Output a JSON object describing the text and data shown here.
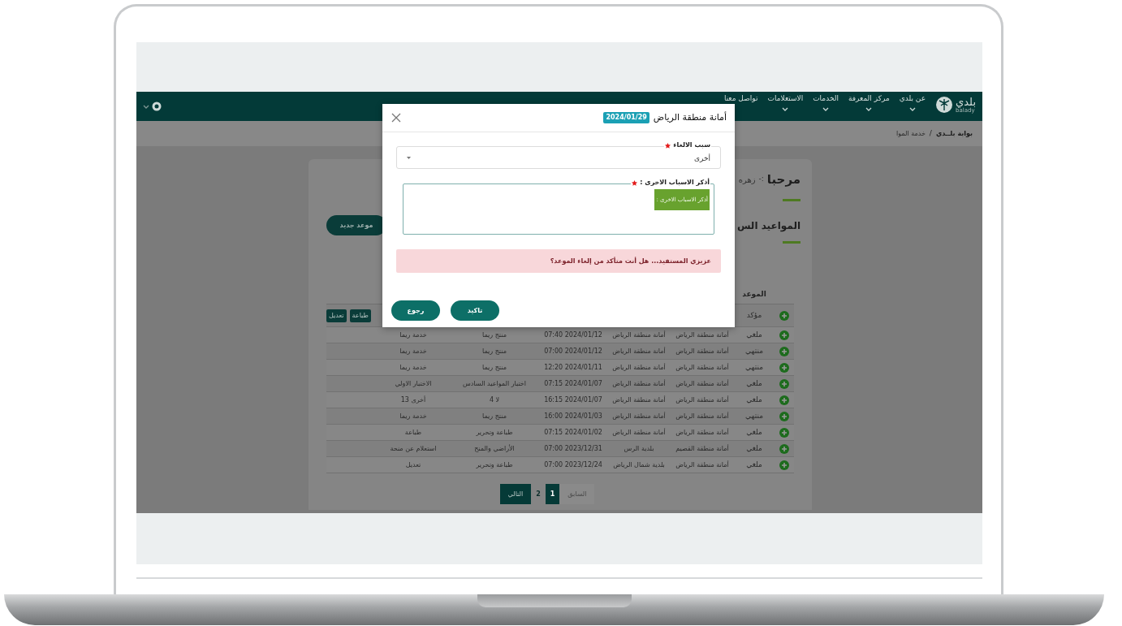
{
  "nav": {
    "logo_text": "بلدي",
    "logo_subtext": "balady",
    "items": [
      {
        "label": "عن بلدي",
        "dropdown": true
      },
      {
        "label": "مركز المعرفة",
        "dropdown": true
      },
      {
        "label": "الخدمات",
        "dropdown": true
      },
      {
        "label": "الاستعلامات",
        "dropdown": true
      },
      {
        "label": "تواصل معنا",
        "dropdown": false
      }
    ]
  },
  "breadcrumb": {
    "items": [
      "بوابة بلــدي",
      "خدمة الموا"
    ],
    "separator": "/"
  },
  "welcome": {
    "greeting": "مرحبا",
    "separator": ":-",
    "name": "زهره"
  },
  "section_title": "المواعيد الس",
  "new_button": "موعد جديد",
  "table": {
    "columns": [
      {
        "label": "الموعد"
      }
    ],
    "rows": [
      {
        "kind": "actions",
        "status": "مؤكد",
        "actions": [
          "طباعة",
          "تعديل"
        ]
      },
      {
        "kind": "data",
        "status": "ملغي",
        "cells": [
          "أمانة منطقة الرياض",
          "أمانة منطقة الرياض",
          "07:40 2024/01/12",
          "منتج ريما",
          "خدمة ريما"
        ]
      },
      {
        "kind": "data",
        "status": "منتهي",
        "cells": [
          "أمانة منطقة الرياض",
          "أمانة منطقة الرياض",
          "07:00 2024/01/12",
          "منتج ريما",
          "خدمة ريما"
        ]
      },
      {
        "kind": "data",
        "status": "منتهي",
        "cells": [
          "أمانة منطقة الرياض",
          "أمانة منطقة الرياض",
          "12:20 2024/01/11",
          "منتج ريما",
          "خدمة ريما"
        ]
      },
      {
        "kind": "data",
        "status": "ملغي",
        "cells": [
          "أمانة منطقة الرياض",
          "أمانة منطقة الرياض",
          "07:15 2024/01/07",
          "اختبار المواعيد السادس",
          "الاختبار الاولي"
        ]
      },
      {
        "kind": "data",
        "status": "ملغي",
        "cells": [
          "أمانة منطقة الرياض",
          "أمانة منطقة الرياض",
          "16:15 2024/01/07",
          "لا 4",
          "أخرى 13"
        ]
      },
      {
        "kind": "data",
        "status": "منتهي",
        "cells": [
          "أمانة منطقة الرياض",
          "أمانة منطقة الرياض",
          "16:00 2024/01/03",
          "منتج ريما",
          "خدمة ريما"
        ]
      },
      {
        "kind": "data",
        "status": "ملغي",
        "cells": [
          "أمانة منطقة الرياض",
          "أمانة منطقة الرياض",
          "07:15 2024/01/02",
          "طباعة وتحرير",
          "طباعة"
        ]
      },
      {
        "kind": "data",
        "status": "ملغي",
        "cells": [
          "أمانة منطقة القصيم",
          "بلدية الرس",
          "07:00 2023/12/31",
          "الأراضي والمنح",
          "استعلام عن منحة"
        ]
      },
      {
        "kind": "data",
        "status": "ملغي",
        "cells": [
          "أمانة منطقة الرياض",
          "بلدية شمال الرياض",
          "07:00 2023/12/24",
          "طباعة وتحرير",
          "تعديل"
        ]
      }
    ]
  },
  "pagination": [
    {
      "label": "السابق",
      "kind": "prev",
      "selected": false,
      "disabled": true
    },
    {
      "label": "1",
      "kind": "page",
      "selected": true,
      "disabled": false
    },
    {
      "label": "2",
      "kind": "page",
      "selected": false,
      "disabled": false
    },
    {
      "label": "التالي",
      "kind": "next",
      "selected": false,
      "disabled": false
    }
  ],
  "modal": {
    "title": "أمانة منطقة الرياض",
    "date_badge": "2024/01/29",
    "fields": [
      {
        "kind": "select",
        "label": "سبب الالغاء",
        "required": true,
        "value": "أخرى"
      },
      {
        "kind": "textarea",
        "label": "أذكر الاسباب الاخرى :",
        "required": true,
        "hint": "أذكر الاسباب الاخرى :"
      }
    ],
    "alert": "عزيزي المستفيد... هل أنت متأكد من إلغاء الموعد؟",
    "buttons": [
      "تاكيد",
      "رجوع"
    ]
  }
}
